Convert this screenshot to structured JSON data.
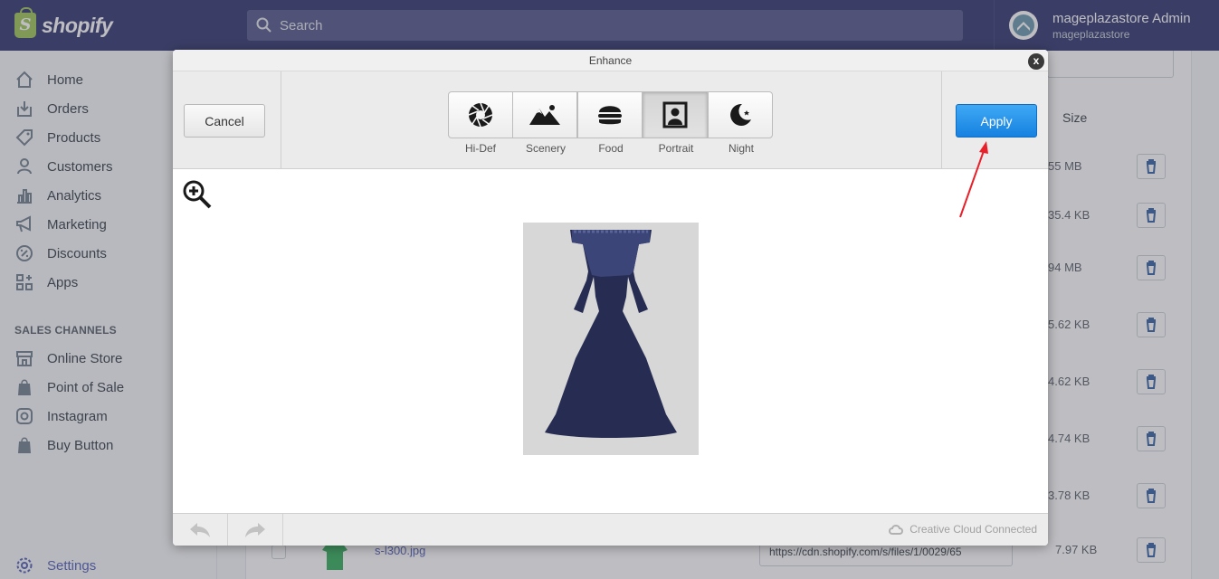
{
  "brand": {
    "name": "shopify",
    "logo_letter": "S"
  },
  "search": {
    "placeholder": "Search"
  },
  "user": {
    "name": "mageplazastore Admin",
    "store": "mageplazastore"
  },
  "sidebar": {
    "items": [
      {
        "label": "Home",
        "icon": "home-icon"
      },
      {
        "label": "Orders",
        "icon": "orders-icon"
      },
      {
        "label": "Products",
        "icon": "tag-icon"
      },
      {
        "label": "Customers",
        "icon": "person-icon"
      },
      {
        "label": "Analytics",
        "icon": "bar-chart-icon"
      },
      {
        "label": "Marketing",
        "icon": "megaphone-icon"
      },
      {
        "label": "Discounts",
        "icon": "discount-icon"
      },
      {
        "label": "Apps",
        "icon": "apps-icon"
      }
    ],
    "section_title": "SALES CHANNELS",
    "channels": [
      {
        "label": "Online Store",
        "icon": "store-icon"
      },
      {
        "label": "Point of Sale",
        "icon": "shopify-bag-icon"
      },
      {
        "label": "Instagram",
        "icon": "instagram-icon"
      },
      {
        "label": "Buy Button",
        "icon": "shopify-bag-icon"
      }
    ],
    "settings": "Settings"
  },
  "files_table": {
    "size_header": "Size",
    "sizes": [
      "55 MB",
      "35.4 KB",
      "94 MB",
      "5.62 KB",
      "4.62 KB",
      "4.74 KB",
      "3.78 KB",
      "7.97 KB"
    ],
    "last_row": {
      "filename": "s-l300.jpg",
      "url": "https://cdn.shopify.com/s/files/1/0029/65"
    }
  },
  "modal": {
    "title": "Enhance",
    "close": "x",
    "cancel_label": "Cancel",
    "apply_label": "Apply",
    "modes": [
      {
        "label": "Hi-Def",
        "icon": "aperture-icon"
      },
      {
        "label": "Scenery",
        "icon": "mountains-icon"
      },
      {
        "label": "Food",
        "icon": "burger-icon"
      },
      {
        "label": "Portrait",
        "icon": "portrait-icon",
        "active": true
      },
      {
        "label": "Night",
        "icon": "moon-icon"
      }
    ],
    "footer_status": "Creative Cloud Connected"
  },
  "colors": {
    "topbar": "#1c2260",
    "apply": "#1f8ceb",
    "annotation": "#e8202a"
  }
}
